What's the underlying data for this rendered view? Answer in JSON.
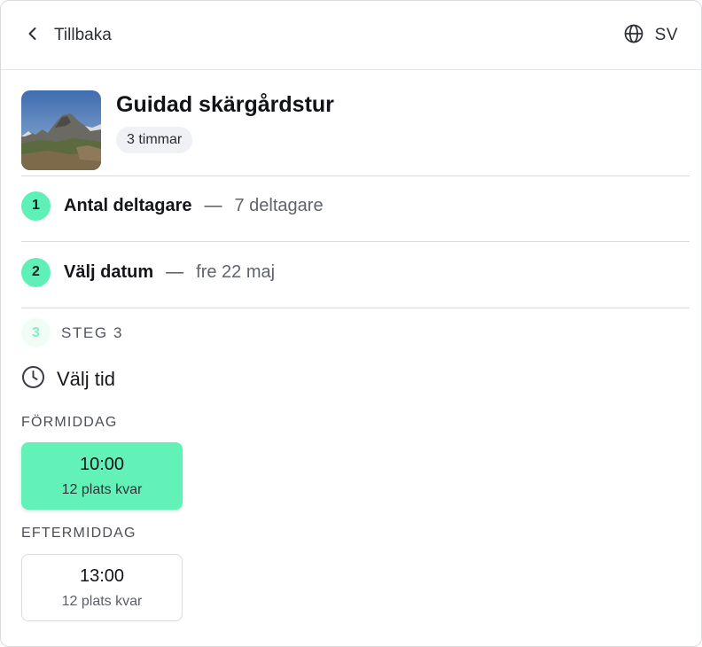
{
  "header": {
    "back_label": "Tillbaka",
    "back_icon": "chevron-left-icon",
    "language_icon": "globe-icon",
    "language_label": "SV"
  },
  "product": {
    "image_alt": "mountain-landscape",
    "title": "Guidad skärgårdstur",
    "duration": "3 timmar"
  },
  "steps": [
    {
      "number": "1",
      "label": "Antal deltagare",
      "separator": "—",
      "value": "7 deltagare",
      "status": "completed"
    },
    {
      "number": "2",
      "label": "Välj datum",
      "separator": "—",
      "value": "fre 22 maj",
      "status": "completed"
    },
    {
      "number": "3",
      "label": "STEG 3",
      "status": "active"
    }
  ],
  "time_picker": {
    "heading": "Välj tid",
    "heading_icon": "clock-icon",
    "groups": [
      {
        "label": "FÖRMIDDAG",
        "slots": [
          {
            "time": "10:00",
            "availability": "12 plats kvar",
            "selected": true
          }
        ]
      },
      {
        "label": "EFTERMIDDAG",
        "slots": [
          {
            "time": "13:00",
            "availability": "12 plats kvar",
            "selected": false
          }
        ]
      }
    ]
  },
  "colors": {
    "accent": "#5ef0b7",
    "accent_light": "#effdf6",
    "divider": "#d9dadd"
  }
}
